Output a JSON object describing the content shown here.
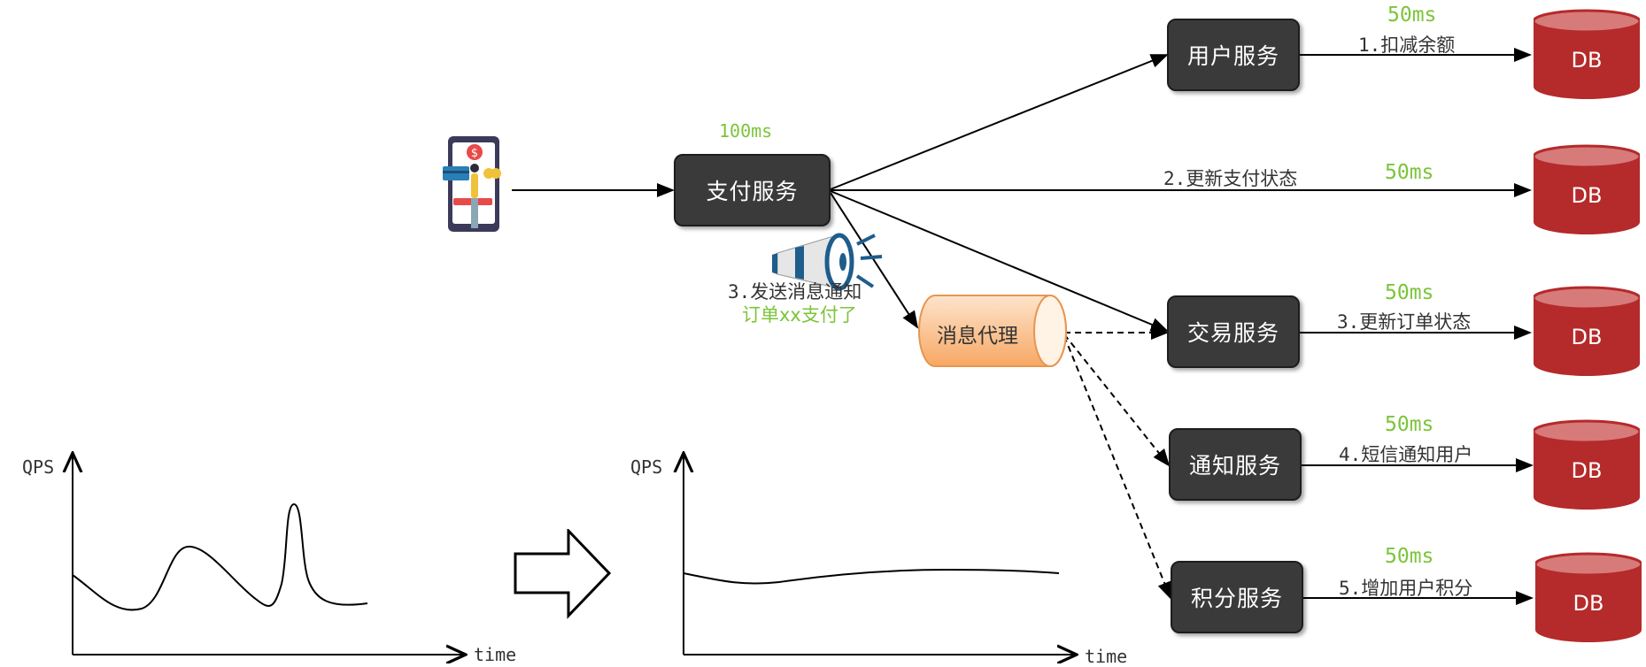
{
  "services": {
    "payment": "支付服务",
    "user": "用户服务",
    "trade": "交易服务",
    "notify": "通知服务",
    "points": "积分服务"
  },
  "broker": "消息代理",
  "timings": {
    "payment": "100ms",
    "user": "50ms",
    "pay_status": "50ms",
    "trade": "50ms",
    "notify": "50ms",
    "points": "50ms"
  },
  "steps": {
    "s1": "1.扣减余额",
    "s2": "2.更新支付状态",
    "s3_trade": "3.更新订单状态",
    "s4": "4.短信通知用户",
    "s5": "5.增加用户积分",
    "s3_msg": "3.发送消息通知",
    "s3_msg_detail": "订单xx支付了"
  },
  "db_label": "DB",
  "charts": {
    "left": {
      "ylabel": "QPS",
      "xlabel": "time"
    },
    "right": {
      "ylabel": "QPS",
      "xlabel": "time"
    }
  },
  "colors": {
    "service_bg": "#3a3a3a",
    "db_red": "#b52a2a",
    "accent_green": "#7cc43a",
    "broker_orange": "#f9b27a"
  },
  "icons": [
    "phone-payment-icon",
    "megaphone-icon",
    "database-icon",
    "right-arrow-icon"
  ]
}
